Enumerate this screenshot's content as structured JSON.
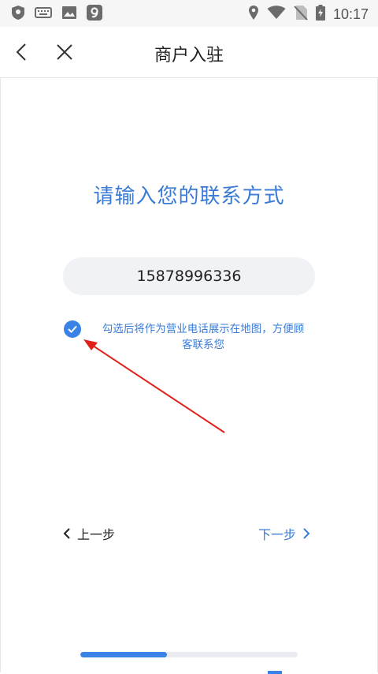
{
  "status_bar": {
    "time": "10:17",
    "left_icons": [
      "shield-icon",
      "keyboard-icon",
      "image-icon",
      "nine-app-icon"
    ],
    "right_icons": [
      "location-icon",
      "wifi-icon",
      "no-sim-icon",
      "battery-charging-icon"
    ]
  },
  "nav": {
    "title": "商户入驻",
    "back_icon": "chevron-left-icon",
    "close_icon": "close-icon"
  },
  "main": {
    "heading": "请输入您的联系方式",
    "phone_value": "15878996336",
    "consent_checked": true,
    "consent_text_line1": "勾选后将作为营业电话展示在地图，方便顾",
    "consent_text_line2": "客联系您"
  },
  "footer": {
    "prev_label": "上一步",
    "next_label": "下一步",
    "progress": 0.4
  },
  "colors": {
    "accent": "#3b82e6",
    "heading": "#3a7bd5",
    "annotation_arrow": "#e0201a",
    "input_bg": "#f1f2f6"
  }
}
